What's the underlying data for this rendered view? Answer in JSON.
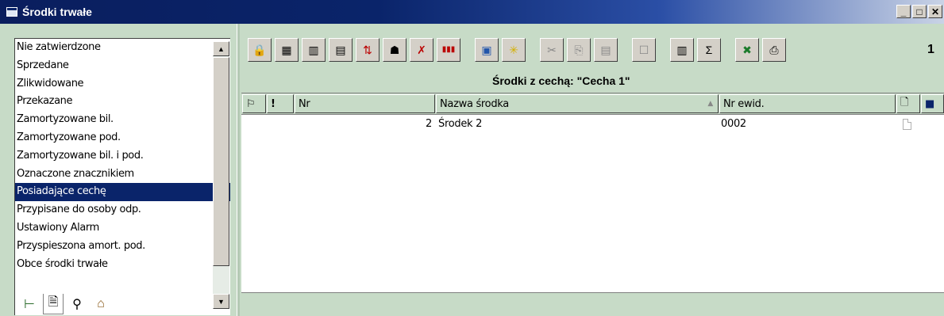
{
  "window": {
    "title": "Środki trwałe",
    "buttons": {
      "minimize": "_",
      "maximize": "□",
      "close": "✕"
    }
  },
  "filter_list": {
    "items": [
      {
        "label": "Nie zatwierdzone"
      },
      {
        "label": "Sprzedane"
      },
      {
        "label": "Zlikwidowane"
      },
      {
        "label": "Przekazane"
      },
      {
        "label": "Zamortyzowane bil."
      },
      {
        "label": "Zamortyzowane pod."
      },
      {
        "label": "Zamortyzowane bil. i pod."
      },
      {
        "label": "Oznaczone znacznikiem"
      },
      {
        "label": "Posiadające cechę",
        "selected": true
      },
      {
        "label": "Przypisane do osoby odp."
      },
      {
        "label": "Ustawiony Alarm"
      },
      {
        "label": "Przyspieszona amort. pod."
      },
      {
        "label": "Obce środki trwałe"
      }
    ],
    "scroll_up": "▲",
    "scroll_down": "▼"
  },
  "bottom_tabs": [
    {
      "icon": "tree-icon",
      "glyph": "⊢"
    },
    {
      "icon": "document-icon",
      "glyph": "🗎",
      "active": true
    },
    {
      "icon": "search-icon",
      "glyph": "⚲"
    },
    {
      "icon": "home-icon",
      "glyph": "⌂"
    }
  ],
  "toolbar": {
    "buttons": [
      {
        "icon": "lock-icon",
        "glyph": "🔒"
      },
      {
        "icon": "calendar-icon",
        "glyph": "▦"
      },
      {
        "icon": "chart-icon",
        "glyph": "▥"
      },
      {
        "icon": "calendar-range-icon",
        "glyph": "▤"
      },
      {
        "icon": "transfer-icon",
        "glyph": "⇅"
      },
      {
        "icon": "people-icon",
        "glyph": "☗"
      },
      {
        "icon": "tools-icon",
        "glyph": "✗"
      },
      {
        "icon": "barcode-icon",
        "glyph": "▮▮▮"
      },
      {
        "icon": "new-document-icon",
        "glyph": "▣"
      },
      {
        "icon": "star-icon",
        "glyph": "✳",
        "disabled": true
      },
      {
        "icon": "cut-icon",
        "glyph": "✂",
        "disabled": true
      },
      {
        "icon": "copy-icon",
        "glyph": "⎘",
        "disabled": true
      },
      {
        "icon": "paste-icon",
        "glyph": "▤",
        "disabled": true
      },
      {
        "icon": "properties-icon",
        "glyph": "☐",
        "disabled": true
      },
      {
        "icon": "columns-icon",
        "glyph": "▥"
      },
      {
        "icon": "sum-icon",
        "glyph": "Σ"
      },
      {
        "icon": "excel-icon",
        "glyph": "✖"
      },
      {
        "icon": "print-icon",
        "glyph": "⎙"
      }
    ],
    "page_number": "1"
  },
  "caption": "Środki z cechą: \"Cecha 1\"",
  "grid": {
    "columns": [
      {
        "label": "",
        "icon": "flag-icon",
        "glyph": "⚐"
      },
      {
        "label": "!"
      },
      {
        "label": "Nr"
      },
      {
        "label": "Nazwa środka",
        "sort": "▲"
      },
      {
        "label": "Nr ewid."
      },
      {
        "label": "",
        "icon": "doc-header-icon",
        "glyph": "🗋"
      },
      {
        "label": "",
        "icon": "color-header-icon",
        "glyph": "■"
      }
    ],
    "rows": [
      {
        "nr": "2",
        "name": "Środek 2",
        "nr_ewid": "0002"
      }
    ]
  }
}
